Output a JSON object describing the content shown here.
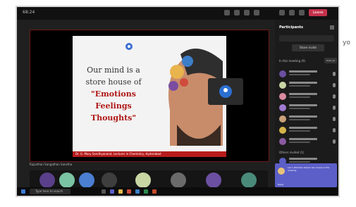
{
  "titlebar": {
    "time": "68:24",
    "leave_label": "Leave"
  },
  "slide": {
    "line1": "Our mind is a",
    "line2": "store house of",
    "line3": "\"Emotions",
    "line4": "Feelings",
    "line5": "Thoughts\"",
    "footer": "Dr. G. Mary Sandhyanand, Lecturer in Chemistry, Hyderabad"
  },
  "panel": {
    "title": "Participants",
    "share_label": "Share invite",
    "in_meeting_label": "In this meeting (9)",
    "mute_all_label": "Mute all",
    "others_label": "Others invited (1)"
  },
  "toast": {
    "text": "Let 1 attendee shares her screen in the meeting",
    "reply": "Reply"
  },
  "pinned_label": "Rajasthan Sangathan Sanstha",
  "taskbar": {
    "search_placeholder": "Type here to search"
  },
  "ghost_text": "yo",
  "colors": {
    "leave": "#c4314b",
    "accent": "#5b5fc7",
    "slide_footer": "#b71c1c"
  }
}
